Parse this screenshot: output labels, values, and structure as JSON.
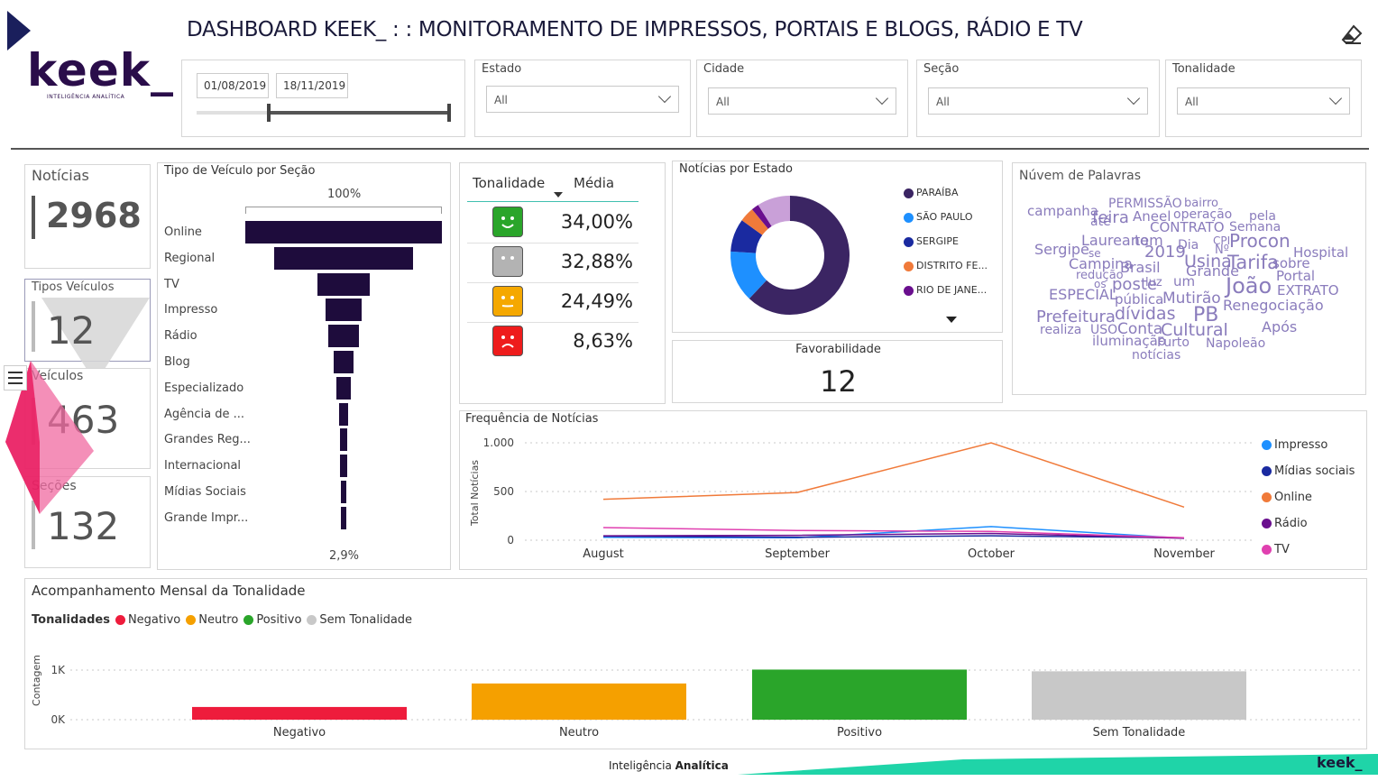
{
  "header": {
    "title": "DASHBOARD KEEK_ : : MONITORAMENTO DE IMPRESSOS, PORTAIS E BLOGS, RÁDIO E TV",
    "logo_text": "keek_",
    "logo_tagline": "INTELIGÊNCIA ANALÍTICA"
  },
  "date_filter": {
    "start": "01/08/2019",
    "end": "18/11/2019"
  },
  "filters": [
    {
      "label": "Estado",
      "value": "All"
    },
    {
      "label": "Cidade",
      "value": "All"
    },
    {
      "label": "Seção",
      "value": "All"
    },
    {
      "label": "Tonalidade",
      "value": "All"
    }
  ],
  "kpis": {
    "noticias": {
      "label": "Notícias",
      "value": "2968"
    },
    "tipos": {
      "label": "Tipos Veículos",
      "value": "12"
    },
    "veiculos": {
      "label": "Veículos",
      "value": "463"
    },
    "secoes": {
      "label": "Seções",
      "value": "132"
    }
  },
  "funnel": {
    "title": "Tipo de Veículo por Seção",
    "top_label": "100%",
    "bottom_label": "2,9%",
    "items": [
      "Online",
      "Regional",
      "TV",
      "Impresso",
      "Rádio",
      "Blog",
      "Especializado",
      "Agência de ...",
      "Grandes Reg...",
      "Internacional",
      "Mídias Sociais",
      "Grande Impr..."
    ],
    "widths": [
      100,
      71,
      27,
      18,
      16,
      10,
      7,
      5,
      4,
      4,
      3,
      3
    ],
    "color": "#1e0c3c"
  },
  "tonalidade_table": {
    "col1": "Tonalidade",
    "col2": "Média",
    "rows": [
      {
        "face": "happy-face-icon",
        "color": "#2aa52a",
        "value": "34,00%"
      },
      {
        "face": "neutral-face-icon",
        "color": "#b3b3b3",
        "value": "32,88%"
      },
      {
        "face": "meh-face-icon",
        "color": "#f5a800",
        "value": "24,49%"
      },
      {
        "face": "sad-face-icon",
        "color": "#ee1c1c",
        "value": "8,63%"
      }
    ]
  },
  "estado_chart": {
    "title": "Notícias por Estado",
    "legend": [
      {
        "name": "PARAÍBA",
        "color": "#3b2563"
      },
      {
        "name": "SÃO PAULO",
        "color": "#1e90ff"
      },
      {
        "name": "SERGIPE",
        "color": "#1a2aa0"
      },
      {
        "name": "DISTRITO FE...",
        "color": "#f07a3a"
      },
      {
        "name": "RIO DE JANE...",
        "color": "#6a0f8e"
      }
    ]
  },
  "favorabilidade": {
    "label": "Favorabilidade",
    "value": "12"
  },
  "word_cloud": {
    "title": "Núvem de Palavras",
    "words": [
      "PERMISSÃO",
      "bairro",
      "campanha",
      "operação",
      "pela",
      "até",
      "feira",
      "Aneel",
      "CONTRATO",
      "Semana",
      "Laureano",
      "tem",
      "Dia",
      "CPI",
      "Procon",
      "Sergipe",
      "se",
      "2019",
      "Nº",
      "Hospital",
      "Campina",
      "Brasil",
      "Usina",
      "Tarifa",
      "sobre",
      "redução",
      "Grande",
      "Portal",
      "os",
      "poste",
      "luz",
      "um",
      "João",
      "EXTRATO",
      "ESPECIAL",
      "pública",
      "Mutirão",
      "Renegociação",
      "Prefeitura",
      "dívidas",
      "PB",
      "Após",
      "realiza",
      "USO",
      "Conta",
      "Cultural",
      "iluminação",
      "Furto",
      "Napoleão",
      "notícias"
    ]
  },
  "frequencia": {
    "title": "Frequência de Notícias",
    "ylabel": "Total Notícias",
    "legend": [
      {
        "name": "Impresso",
        "color": "#1e90ff"
      },
      {
        "name": "Mídias sociais",
        "color": "#1a2aa0"
      },
      {
        "name": "Online",
        "color": "#f07a3a"
      },
      {
        "name": "Rádio",
        "color": "#6a0f8e"
      },
      {
        "name": "TV",
        "color": "#e040b0"
      }
    ]
  },
  "acompanhamento": {
    "title": "Acompanhamento Mensal da Tonalidade",
    "legend_label": "Tonalidades",
    "legend": [
      {
        "name": "Negativo",
        "color": "#ee1c3c"
      },
      {
        "name": "Neutro",
        "color": "#f5a000"
      },
      {
        "name": "Positivo",
        "color": "#2aa52a"
      },
      {
        "name": "Sem Tonalidade",
        "color": "#c8c8c8"
      }
    ],
    "ylabel": "Contagem"
  },
  "footer": {
    "text_regular": "Inteligência ",
    "text_bold": "Analítica",
    "brand": "keek_"
  },
  "chart_data": [
    {
      "type": "pie",
      "title": "Notícias por Estado",
      "categories": [
        "PARAÍBA",
        "SÃO PAULO",
        "SERGIPE",
        "DISTRITO FE...",
        "RIO DE JANE...",
        "Outros"
      ],
      "values": [
        62,
        14,
        9,
        4,
        2,
        9
      ],
      "colors": [
        "#3b2563",
        "#1e90ff",
        "#1a2aa0",
        "#f07a3a",
        "#6a0f8e",
        "#c9a0d8"
      ]
    },
    {
      "type": "line",
      "title": "Frequência de Notícias",
      "ylabel": "Total Notícias",
      "x": [
        "August",
        "September",
        "October",
        "November"
      ],
      "yticks": [
        "0",
        "500",
        "1.000"
      ],
      "ylim": [
        0,
        1000
      ],
      "series": [
        {
          "name": "Impresso",
          "color": "#1e90ff",
          "values": [
            30,
            25,
            140,
            20
          ]
        },
        {
          "name": "Mídias sociais",
          "color": "#1a2aa0",
          "values": [
            40,
            30,
            45,
            25
          ]
        },
        {
          "name": "Online",
          "color": "#f07a3a",
          "values": [
            420,
            490,
            1000,
            340
          ]
        },
        {
          "name": "Rádio",
          "color": "#6a0f8e",
          "values": [
            45,
            50,
            70,
            20
          ]
        },
        {
          "name": "TV",
          "color": "#e040b0",
          "values": [
            130,
            100,
            90,
            25
          ]
        }
      ]
    },
    {
      "type": "bar",
      "title": "Acompanhamento Mensal da Tonalidade",
      "ylabel": "Contagem",
      "categories": [
        "Negativo",
        "Neutro",
        "Positivo",
        "Sem Tonalidade"
      ],
      "values": [
        256,
        730,
        1010,
        975
      ],
      "colors": [
        "#ee1c3c",
        "#f5a000",
        "#2aa52a",
        "#c8c8c8"
      ],
      "yticks": [
        "0K",
        "1K"
      ],
      "ylim": [
        0,
        1000
      ]
    }
  ]
}
